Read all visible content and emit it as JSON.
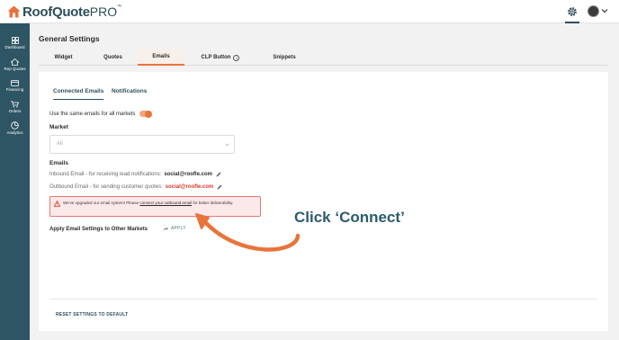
{
  "app": {
    "logo_main": "RoofQuote",
    "logo_suffix": "PRO",
    "logo_tm": "™"
  },
  "topbar": {
    "settings_icon": "gear-icon",
    "avatar_icon": "avatar",
    "menu_icon": "chevron-down-icon"
  },
  "sidebar": {
    "items": [
      {
        "label": "Dashboard",
        "icon": "dashboard-icon"
      },
      {
        "label": "Rep Quotes",
        "icon": "house-icon"
      },
      {
        "label": "Financing",
        "icon": "card-icon"
      },
      {
        "label": "Orders",
        "icon": "cart-icon"
      },
      {
        "label": "Analytics",
        "icon": "pie-icon"
      }
    ]
  },
  "page": {
    "title": "General Settings"
  },
  "tabs": [
    {
      "label": "Widget",
      "active": false
    },
    {
      "label": "Quotes",
      "active": false
    },
    {
      "label": "Emails",
      "active": true
    },
    {
      "label": "CLP Button",
      "active": false,
      "info": "i"
    },
    {
      "label": "Snippets",
      "active": false
    }
  ],
  "subtabs": [
    {
      "label": "Connected Emails",
      "active": true
    },
    {
      "label": "Notifications",
      "active": false
    }
  ],
  "emails": {
    "same_emails_label": "Use the same emails for all markets",
    "same_emails_enabled": true,
    "market_label": "Market",
    "market_value": "All",
    "emails_label": "Emails",
    "inbound_label": "Inbound Email - for receiving lead notifications:",
    "inbound_value": "social@roofle.com",
    "outbound_label": "Outbound Email - for sending customer quotes:",
    "outbound_value": "social@roofle.com",
    "alert_prefix": "We've upgraded our email system! Please",
    "alert_link": "connect your outbound email",
    "alert_suffix": "for better deliverability.",
    "apply_label": "Apply Email Settings to Other Markets",
    "apply_button": "APPLY",
    "reset_button": "RESET SETTINGS TO DEFAULT"
  },
  "annotation": {
    "callout": "Click ‘Connect’"
  },
  "colors": {
    "accent": "#e8743b",
    "sidebar": "#2e5563",
    "brand_text": "#2d4f5c",
    "alert_border": "#e57878",
    "alert_bg": "#fbe8e8",
    "error_text": "#d9372b"
  }
}
